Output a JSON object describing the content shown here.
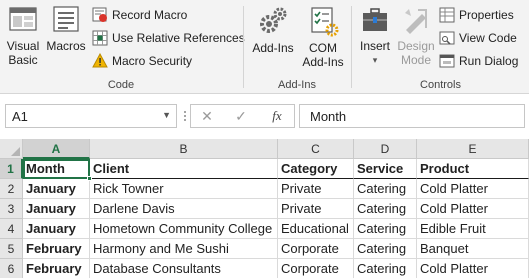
{
  "ribbon": {
    "code_group": {
      "label": "Code",
      "visual_basic_line1": "Visual",
      "visual_basic_line2": "Basic",
      "macros": "Macros",
      "record_macro": "Record Macro",
      "use_relative_references": "Use Relative References",
      "macro_security": "Macro Security"
    },
    "addins_group": {
      "label": "Add-Ins",
      "add_ins": "Add-Ins",
      "com_addins_line1": "COM",
      "com_addins_line2": "Add-Ins"
    },
    "controls_group": {
      "label": "Controls",
      "insert": "Insert",
      "insert_arrow": "▾",
      "design_mode_line1": "Design",
      "design_mode_line2": "Mode",
      "properties": "Properties",
      "view_code": "View Code",
      "run_dialog": "Run Dialog"
    }
  },
  "formula_bar": {
    "name_box": "A1",
    "cancel_glyph": "✕",
    "enter_glyph": "✓",
    "function_glyph": "fx",
    "formula_value": "Month"
  },
  "sheet": {
    "columns": [
      "A",
      "B",
      "C",
      "D",
      "E"
    ],
    "rows": [
      "1",
      "2",
      "3",
      "4",
      "5",
      "6"
    ],
    "header": [
      "Month",
      "Client",
      "Category",
      "Service",
      "Product"
    ],
    "data": [
      [
        "January",
        "Rick Towner",
        "Private",
        "Catering",
        "Cold Platter"
      ],
      [
        "January",
        "Darlene Davis",
        "Private",
        "Catering",
        "Cold Platter"
      ],
      [
        "January",
        "Hometown Community College",
        "Educational",
        "Catering",
        "Edible Fruit"
      ],
      [
        "February",
        "Harmony and Me Sushi",
        "Corporate",
        "Catering",
        "Banquet"
      ],
      [
        "February",
        "Database Consultants",
        "Corporate",
        "Catering",
        "Cold Platter"
      ]
    ]
  },
  "colors": {
    "accent": "#217346",
    "ribbon_bg": "#f3f3f3",
    "header_bg": "#e6e6e6"
  }
}
